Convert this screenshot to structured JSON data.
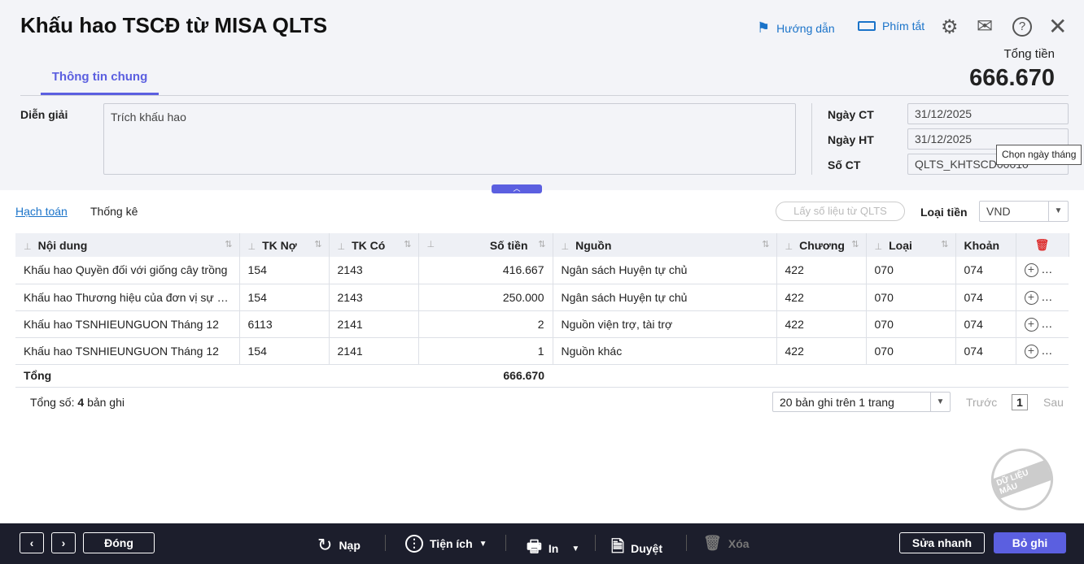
{
  "header": {
    "title": "Khấu hao TSCĐ từ MISA QLTS",
    "guide": "Hướng dẫn",
    "shortcuts": "Phím tắt",
    "total_label": "Tổng tiền",
    "total_value": "666.670"
  },
  "tabs": [
    {
      "label": "Thông tin chung",
      "active": true
    }
  ],
  "form": {
    "description_label": "Diễn giải",
    "description_value": "Trích khấu hao",
    "date_ct_label": "Ngày CT",
    "date_ct": "31/12/2025",
    "date_ht_label": "Ngày HT",
    "date_ht": "31/12/2025",
    "so_ct_label": "Số CT",
    "so_ct": "QLTS_KHTSCD00010",
    "tooltip": "Chọn ngày tháng"
  },
  "detail_tabs": [
    "Hạch toán",
    "Thống kê"
  ],
  "fetch_button": "Lấy số liệu từ QLTS",
  "currency": {
    "label": "Loại tiền",
    "value": "VND"
  },
  "table": {
    "columns": [
      "Nội dung",
      "TK Nợ",
      "TK Có",
      "Số tiền",
      "Nguồn",
      "Chương",
      "Loại",
      "Khoản"
    ],
    "rows": [
      [
        "Khấu hao Quyền đối với giống cây trồng",
        "154",
        "2143",
        "416.667",
        "Ngân sách Huyện tự chủ",
        "422",
        "070",
        "074"
      ],
      [
        "Khấu hao Thương hiệu của đơn vị sự nghiệp",
        "154",
        "2143",
        "250.000",
        "Ngân sách Huyện tự chủ",
        "422",
        "070",
        "074"
      ],
      [
        "Khấu hao TSNHIEUNGUON Tháng 12",
        "6113",
        "2141",
        "2",
        "Nguồn viện trợ, tài trợ",
        "422",
        "070",
        "074"
      ],
      [
        "Khấu hao TSNHIEUNGUON Tháng 12",
        "154",
        "2141",
        "1",
        "Nguồn khác",
        "422",
        "070",
        "074"
      ]
    ],
    "total_label": "Tổng",
    "total_value": "666.670"
  },
  "pager": {
    "count_prefix": "Tổng số:",
    "count": "4",
    "count_suffix": "bản ghi",
    "page_size": "20 bản ghi trên 1 trang",
    "prev": "Trước",
    "page": "1",
    "next": "Sau"
  },
  "watermark": "DỮ LIỆU MẪU",
  "footer": {
    "close": "Đóng",
    "reload": "Nạp",
    "utilities": "Tiện ích",
    "print": "In",
    "approve": "Duyệt",
    "delete": "Xóa",
    "quick_edit": "Sửa nhanh",
    "save": "Bỏ ghi"
  },
  "colors": {
    "accent": "#5b5fe0",
    "link": "#1a73c9",
    "footer_bg": "#1c1e2c"
  }
}
